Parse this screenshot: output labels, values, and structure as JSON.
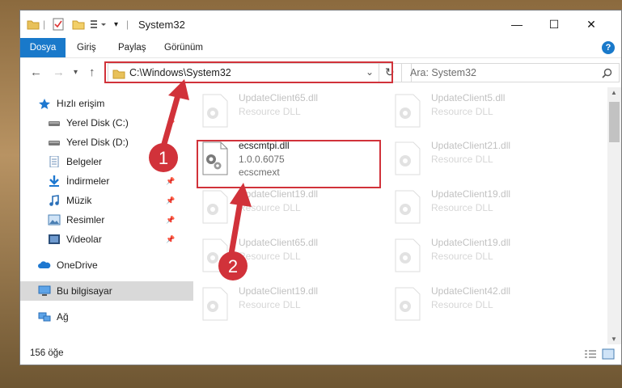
{
  "window": {
    "title": "System32"
  },
  "ribbon": {
    "tabs": [
      "Dosya",
      "Giriş",
      "Paylaş",
      "Görünüm"
    ],
    "help": "?"
  },
  "window_controls": {
    "minimize": "—",
    "maximize": "☐",
    "close": "✕"
  },
  "address": {
    "path": "C:\\Windows\\System32"
  },
  "search": {
    "placeholder": "Ara: System32"
  },
  "sidebar": {
    "quick_access": "Hızlı erişim",
    "items": [
      {
        "label": "Yerel Disk (C:)",
        "icon": "drive-icon"
      },
      {
        "label": "Yerel Disk (D:)",
        "icon": "drive-icon"
      },
      {
        "label": "Belgeler",
        "icon": "documents-icon"
      },
      {
        "label": "İndirmeler",
        "icon": "download-icon"
      },
      {
        "label": "Müzik",
        "icon": "music-icon"
      },
      {
        "label": "Resimler",
        "icon": "pictures-icon"
      },
      {
        "label": "Videolar",
        "icon": "videos-icon"
      }
    ],
    "onedrive": "OneDrive",
    "this_pc": "Bu bilgisayar",
    "network": "Ağ"
  },
  "files": [
    {
      "name": "UpdateClient65.dll",
      "l2": "Resource DLL",
      "l3": ""
    },
    {
      "name": "UpdateClient5.dll",
      "l2": "Resource DLL",
      "l3": ""
    },
    {
      "name": "ecscmtpi.dll",
      "l2": "1.0.0.6075",
      "l3": "ecscmext"
    },
    {
      "name": "UpdateClient21.dll",
      "l2": "Resource DLL",
      "l3": ""
    },
    {
      "name": "UpdateClient19.dll",
      "l2": "Resource DLL",
      "l3": ""
    },
    {
      "name": "UpdateClient19.dll",
      "l2": "Resource DLL",
      "l3": ""
    },
    {
      "name": "UpdateClient65.dll",
      "l2": "Resource DLL",
      "l3": ""
    },
    {
      "name": "UpdateClient19.dll",
      "l2": "Resource DLL",
      "l3": ""
    },
    {
      "name": "UpdateClient19.dll",
      "l2": "Resource DLL",
      "l3": ""
    },
    {
      "name": "UpdateClient42.dll",
      "l2": "Resource DLL",
      "l3": ""
    }
  ],
  "status": {
    "count": "156 öğe"
  },
  "annotations": {
    "step1": "1",
    "step2": "2",
    "color": "#d1323a"
  }
}
